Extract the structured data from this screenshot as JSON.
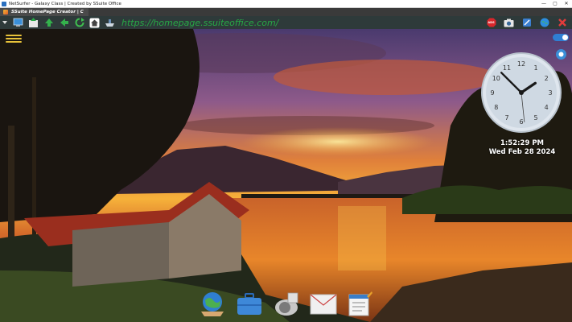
{
  "window": {
    "title": "NetSurfer - Galaxy Class | Created by SSuite Office",
    "controls": [
      "—",
      "▢",
      "✕"
    ]
  },
  "tabs": [
    {
      "label": "SSuite HomePage Creator | C",
      "icon": "homepage-creator-icon"
    }
  ],
  "toolbar": {
    "url": "https://homepage.ssuiteoffice.com/",
    "left_icons": [
      "tab-arrow-icon",
      "screen-icon",
      "upload-icon",
      "back-icon",
      "forward-icon",
      "refresh-icon",
      "home-icon",
      "ship-icon"
    ],
    "right_icons": [
      "adblock-icon",
      "camera-icon",
      "pen-icon",
      "globe-icon",
      "close-icon"
    ],
    "adblock_label": "ADS"
  },
  "desktop": {
    "clock_time": "1:52:29 PM",
    "clock_date": "Wed Feb 28 2024",
    "clock_hands": {
      "hour": 1,
      "minute": 52,
      "second": 29
    },
    "dock": [
      "globe-app-icon",
      "briefcase-app-icon",
      "speaker-app-icon",
      "mail-app-icon",
      "notepad-app-icon"
    ]
  },
  "colors": {
    "url": "#27a845",
    "toolbar_bg": "#2e3a3a",
    "menu_icon": "#e8c23a",
    "toggle": "#2f7fd3"
  }
}
